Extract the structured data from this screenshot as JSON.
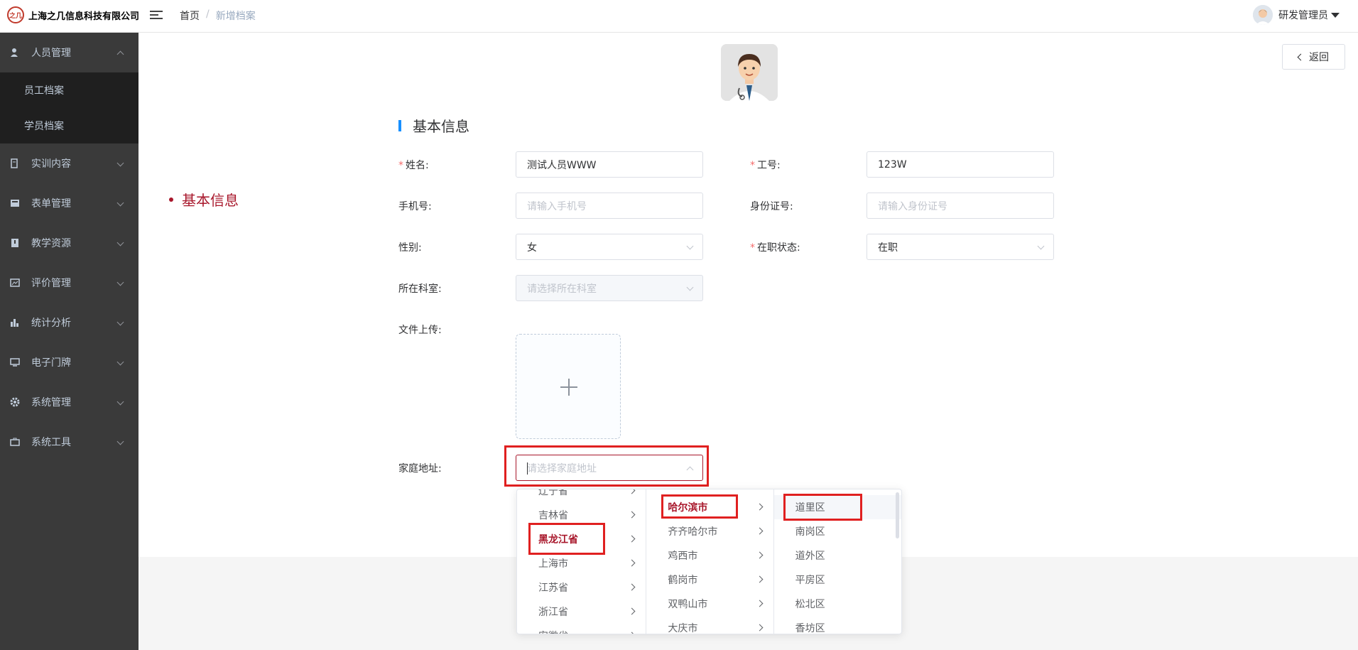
{
  "header": {
    "logo_mark": "之几",
    "company": "上海之几信息科技有限公司",
    "breadcrumb_home": "首页",
    "breadcrumb_sep": "/",
    "breadcrumb_current": "新增档案",
    "user_name": "研发管理员"
  },
  "sidebar": {
    "items": [
      {
        "label": "人员管理"
      },
      {
        "label": "实训内容"
      },
      {
        "label": "表单管理"
      },
      {
        "label": "教学资源"
      },
      {
        "label": "评价管理"
      },
      {
        "label": "统计分析"
      },
      {
        "label": "电子门牌"
      },
      {
        "label": "系统管理"
      },
      {
        "label": "系统工具"
      }
    ],
    "sub_items": [
      {
        "label": "员工档案"
      },
      {
        "label": "学员档案"
      }
    ]
  },
  "page": {
    "back_label": "返回",
    "anchor_label": "基本信息",
    "section_title": "基本信息"
  },
  "form": {
    "name_label": "姓名:",
    "name_value": "测试人员WWW",
    "job_no_label": "工号:",
    "job_no_value": "123W",
    "phone_label": "手机号:",
    "phone_placeholder": "请输入手机号",
    "id_label": "身份证号:",
    "id_placeholder": "请输入身份证号",
    "gender_label": "性别:",
    "gender_value": "女",
    "status_label": "在职状态:",
    "status_value": "在职",
    "dept_label": "所在科室:",
    "dept_placeholder": "请选择所在科室",
    "upload_label": "文件上传:",
    "address_label": "家庭地址:",
    "address_placeholder": "请选择家庭地址"
  },
  "cascader": {
    "provinces": [
      "辽宁省",
      "吉林省",
      "黑龙江省",
      "上海市",
      "江苏省",
      "浙江省",
      "安徽省"
    ],
    "cities": [
      "哈尔滨市",
      "齐齐哈尔市",
      "鸡西市",
      "鹤岗市",
      "双鸭山市",
      "大庆市"
    ],
    "districts": [
      "道里区",
      "南岗区",
      "道外区",
      "平房区",
      "松北区",
      "香坊区"
    ],
    "selected_province": "黑龙江省",
    "selected_city": "哈尔滨市",
    "selected_district": "道里区"
  },
  "colors": {
    "accent": "#a8172b",
    "sidebar_bg": "#3a3a3a",
    "title_bar": "#1890ff",
    "highlight_box": "#e02020"
  }
}
